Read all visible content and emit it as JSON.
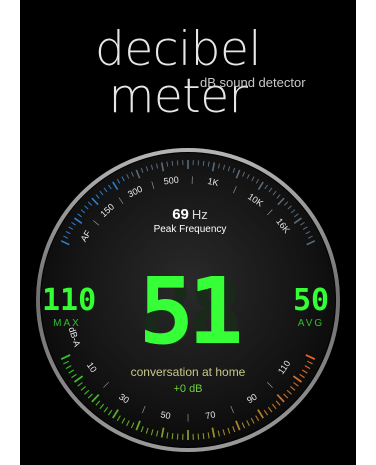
{
  "app": {
    "title": "decibel meter",
    "subtitle": "dB sound detector"
  },
  "meter": {
    "current_db": "51",
    "ghost_digits": "88",
    "peak_frequency": {
      "value": "69",
      "unit": "Hz",
      "label": "Peak Frequency"
    },
    "max": {
      "value": "110",
      "label": "MAX"
    },
    "avg": {
      "value": "50",
      "label": "AVG"
    },
    "weighting": "dB-A",
    "description": "conversation at home",
    "offset": "+0 dB",
    "frequency_scale": [
      "AF",
      "150",
      "300",
      "500",
      "1K",
      "10K",
      "16K"
    ],
    "db_scale": [
      "10",
      "30",
      "50",
      "70",
      "90",
      "110"
    ]
  },
  "colors": {
    "accent_green": "#37ff37",
    "frequency_arc": "#2e7dc8",
    "ring": "#8c8c8c",
    "description_text": "#c8c88a"
  }
}
